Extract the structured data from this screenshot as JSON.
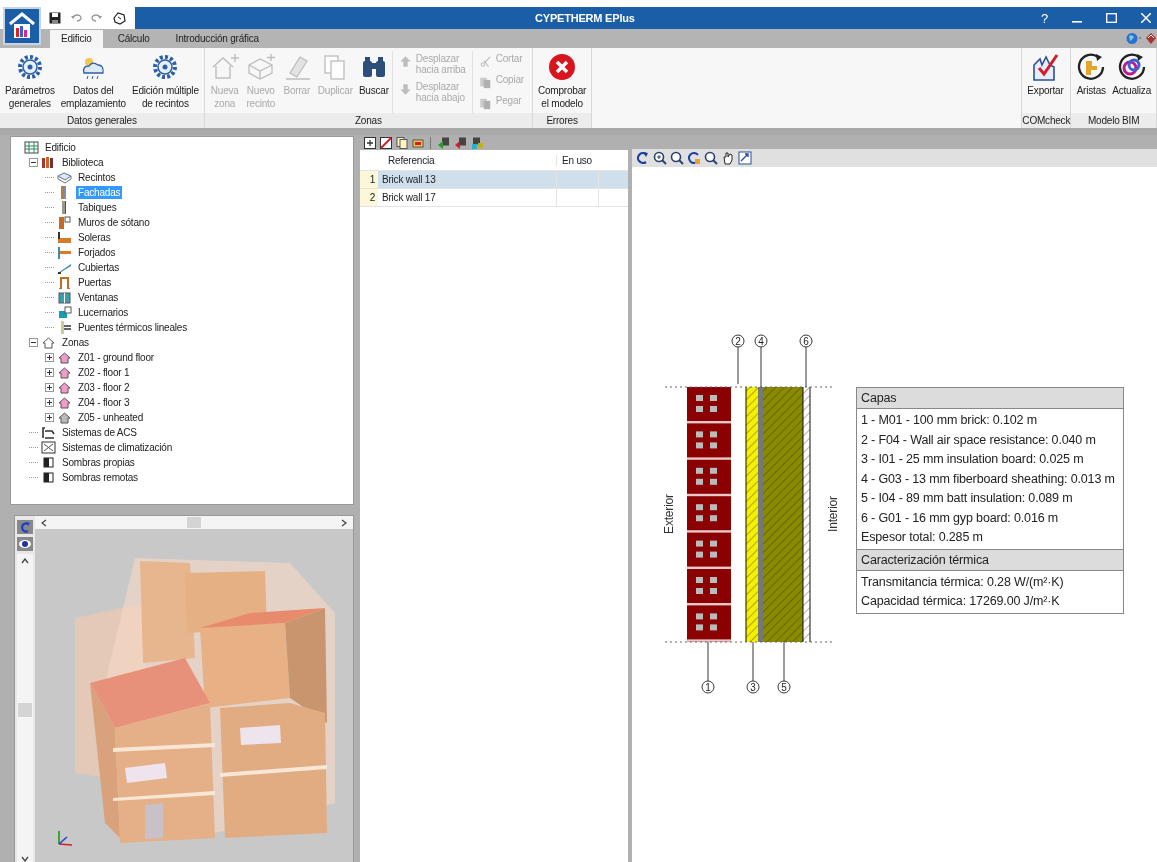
{
  "window": {
    "title": "CYPETHERM EPlus",
    "help": "?"
  },
  "tabs": [
    {
      "label": "Edificio",
      "selected": true
    },
    {
      "label": "Cálculo",
      "selected": false
    },
    {
      "label": "Introducción gráfica",
      "selected": false
    }
  ],
  "ribbon": {
    "groups": [
      {
        "label": "Datos generales",
        "columns": [
          [
            {
              "kind": "large",
              "lines": [
                "Parámetros",
                "generales"
              ],
              "disabled": false
            }
          ],
          [
            {
              "kind": "large",
              "lines": [
                "Datos del",
                "emplazamiento"
              ],
              "disabled": false
            }
          ],
          [
            {
              "kind": "large",
              "lines": [
                "Edición múltiple",
                "de recintos"
              ],
              "disabled": false
            }
          ]
        ]
      },
      {
        "label": "Zonas",
        "columns": [
          [
            {
              "kind": "large",
              "lines": [
                "Nueva",
                "zona"
              ],
              "disabled": true
            }
          ],
          [
            {
              "kind": "large",
              "lines": [
                "Nuevo",
                "recinto"
              ],
              "disabled": true
            }
          ],
          [
            {
              "kind": "large",
              "lines": [
                "Borrar"
              ],
              "disabled": true
            }
          ],
          [
            {
              "kind": "large",
              "lines": [
                "Duplicar"
              ],
              "disabled": true
            }
          ],
          [
            {
              "kind": "large",
              "lines": [
                "Buscar"
              ],
              "disabled": false
            }
          ],
          [
            {
              "kind": "small",
              "lines": [
                "Desplazar",
                "hacia arriba"
              ],
              "disabled": true
            },
            {
              "kind": "small",
              "lines": [
                "Desplazar",
                "hacia abajo"
              ],
              "disabled": true
            }
          ],
          [
            {
              "kind": "small",
              "lines": [
                "Cortar"
              ],
              "disabled": true
            },
            {
              "kind": "small",
              "lines": [
                "Copiar"
              ],
              "disabled": true
            },
            {
              "kind": "small",
              "lines": [
                "Pegar"
              ],
              "disabled": true
            }
          ]
        ]
      },
      {
        "label": "Errores",
        "columns": [
          [
            {
              "kind": "large",
              "lines": [
                "Comprobar",
                "el modelo"
              ],
              "disabled": false
            }
          ]
        ]
      },
      {
        "label": "COMcheck",
        "columns": [
          [
            {
              "kind": "large",
              "lines": [
                "Exportar"
              ],
              "disabled": false
            }
          ]
        ]
      },
      {
        "label": "Modelo BIM",
        "columns": [
          [
            {
              "kind": "large",
              "lines": [
                "Aristas"
              ],
              "disabled": false
            }
          ],
          [
            {
              "kind": "large",
              "lines": [
                "Actualiza"
              ],
              "disabled": false
            }
          ]
        ]
      }
    ]
  },
  "tree": [
    {
      "label": "Edificio",
      "selected": false,
      "children": [
        {
          "label": "Biblioteca",
          "selected": false,
          "expanded": true,
          "children": [
            {
              "label": "Recintos",
              "selected": false
            },
            {
              "label": "Fachadas",
              "selected": true
            },
            {
              "label": "Tabiques",
              "selected": false
            },
            {
              "label": "Muros de sótano",
              "selected": false
            },
            {
              "label": "Soleras",
              "selected": false
            },
            {
              "label": "Forjados",
              "selected": false
            },
            {
              "label": "Cubiertas",
              "selected": false
            },
            {
              "label": "Puertas",
              "selected": false
            },
            {
              "label": "Ventanas",
              "selected": false
            },
            {
              "label": "Lucernarios",
              "selected": false
            },
            {
              "label": "Puentes térmicos lineales",
              "selected": false
            }
          ]
        },
        {
          "label": "Zonas",
          "selected": false,
          "expanded": true,
          "children": [
            {
              "label": "Z01 - ground floor",
              "selected": false,
              "expanded": false
            },
            {
              "label": "Z02 - floor 1",
              "selected": false,
              "expanded": false
            },
            {
              "label": "Z03 - floor 2",
              "selected": false,
              "expanded": false
            },
            {
              "label": "Z04 - floor 3",
              "selected": false,
              "expanded": false
            },
            {
              "label": "Z05 - unheated",
              "selected": false,
              "expanded": false
            }
          ]
        },
        {
          "label": "Sistemas de ACS",
          "selected": false
        },
        {
          "label": "Sistemas de climatización",
          "selected": false
        },
        {
          "label": "Sombras propias",
          "selected": false
        },
        {
          "label": "Sombras remotas",
          "selected": false
        }
      ]
    }
  ],
  "table": {
    "columns": [
      "Referencia",
      "En uso"
    ],
    "rows": [
      {
        "number": "1",
        "reference": "Brick wall 13",
        "selected": true
      },
      {
        "number": "2",
        "reference": "Brick wall 17",
        "selected": false
      }
    ]
  },
  "section": {
    "exterior_label": "Exterior",
    "interior_label": "Interior",
    "callouts": [
      "1",
      "2",
      "3",
      "4",
      "5",
      "6"
    ],
    "legend": [
      {
        "title": "Capas",
        "lines": [
          "1 - M01 - 100 mm brick: 0.102 m",
          "2 - F04 - Wall air space resistance: 0.040 m",
          "3 - I01 - 25 mm insulation board: 0.025 m",
          "4 - G03 - 13 mm fiberboard sheathing: 0.013 m",
          "5 - I04 - 89 mm batt insulation: 0.089 m",
          "6 - G01 - 16 mm gyp board: 0.016 m",
          "Espesor total: 0.285 m"
        ]
      },
      {
        "title": "Caracterización térmica",
        "lines": [
          "Transmitancia térmica: 0.28 W/(m²·K)",
          "Capacidad térmica: 17269.00 J/m²·K"
        ]
      }
    ]
  }
}
